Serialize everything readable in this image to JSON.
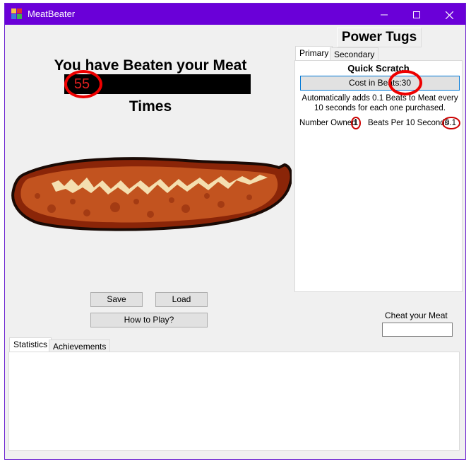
{
  "window": {
    "title": "MeatBeater",
    "controls": {
      "minimize": "—",
      "maximize": "☐",
      "close": "✕"
    }
  },
  "counter": {
    "prefix": "You have Beaten your Meat",
    "value": "55",
    "suffix": "Times"
  },
  "buttons": {
    "save": "Save",
    "load": "Load",
    "how_to_play": "How to Play?"
  },
  "power_tugs": {
    "title": "Power Tugs",
    "tabs": [
      "Primary",
      "Secondary"
    ],
    "upgrade": {
      "name": "Quick Scratch",
      "cost_label": "Cost in Beats:30",
      "description": "Automatically adds 0.1 Beats to Meat every 10 seconds for each one purchased.",
      "owned_label": "Number Owned",
      "owned_value": "1",
      "rate_label": "Beats Per 10 Seconds",
      "rate_value": "0.1"
    }
  },
  "cheat": {
    "label": "Cheat your Meat",
    "value": ""
  },
  "bottom_tabs": [
    "Statistics",
    "Achievements"
  ],
  "colors": {
    "titlebar": "#6a00d8",
    "highlight": "#e00000"
  }
}
